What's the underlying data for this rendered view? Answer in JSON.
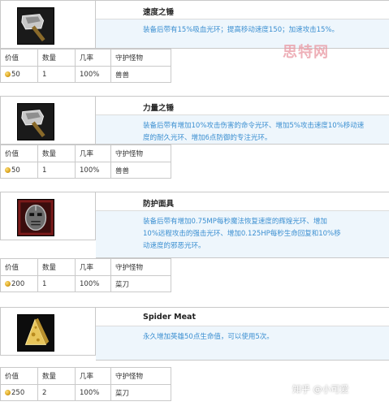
{
  "table_headers": {
    "value": "价值",
    "quantity": "数量",
    "rate": "几率",
    "guardian": "守护怪物"
  },
  "items": [
    {
      "name": "速度之锤",
      "description": "装备后带有15%吸血光环；提高移动速度150；加速攻击15%。",
      "icon": "hammer-icon",
      "value": "50",
      "quantity": "1",
      "rate": "100%",
      "guardian": "兽兽"
    },
    {
      "name": "力量之锤",
      "description": "装备后带有增加10%攻击伤害的命令光环、增加5%攻击速度10%移动速度的耐久光环、增加6点防御的专注光环。",
      "icon": "hammer-icon",
      "value": "50",
      "quantity": "1",
      "rate": "100%",
      "guardian": "兽兽"
    },
    {
      "name": "防护面具",
      "description": "装备后带有增加0.75MP每秒魔法恢复速度的辉煌光环、增加10%远程攻击的强击光环、增加0.125HP每秒生命回复和10%移动速度的邪恶光环。",
      "icon": "mask-icon",
      "value": "200",
      "quantity": "1",
      "rate": "100%",
      "guardian": "菜刀"
    },
    {
      "name": "Spider Meat",
      "description": "永久增加英雄50点生命值，可以使用5次。",
      "icon": "cheese-icon",
      "value": "250",
      "quantity": "2",
      "rate": "100%",
      "guardian": "菜刀"
    }
  ],
  "watermark": "思特网",
  "zhihu_credit": "知乎 @小可爱"
}
